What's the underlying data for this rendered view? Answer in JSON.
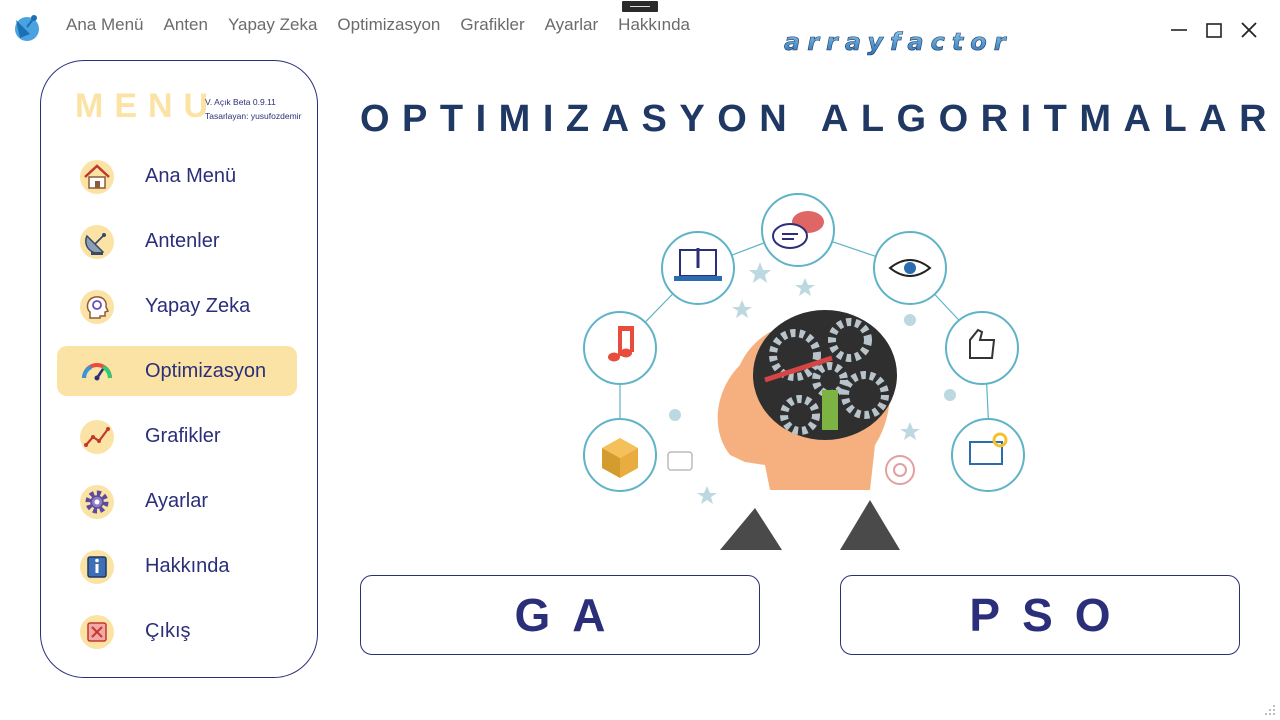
{
  "window": {
    "menu": [
      "Ana Menü",
      "Anten",
      "Yapay Zeka",
      "Optimizasyon",
      "Grafikler",
      "Ayarlar",
      "Hakkında"
    ],
    "wordmark": "arrayfactor"
  },
  "sidebar": {
    "title": "MENU",
    "version": "V. Açık Beta 0.9.11",
    "author": "Tasarlayan: yusufozdemir",
    "items": [
      {
        "label": "Ana Menü",
        "icon": "home-icon"
      },
      {
        "label": "Antenler",
        "icon": "satellite-dish-icon"
      },
      {
        "label": "Yapay Zeka",
        "icon": "ai-head-icon"
      },
      {
        "label": "Optimizasyon",
        "icon": "gauge-icon",
        "active": true
      },
      {
        "label": "Grafikler",
        "icon": "line-chart-icon"
      },
      {
        "label": "Ayarlar",
        "icon": "gear-icon"
      },
      {
        "label": "Hakkında",
        "icon": "info-icon"
      },
      {
        "label": "Çıkış",
        "icon": "exit-icon"
      }
    ]
  },
  "main": {
    "title": "OPTIMIZASYON ALGORITMALARI",
    "buttons": {
      "ga": "GA",
      "pso": "PSO"
    }
  },
  "colors": {
    "accent": "#fbe3a5",
    "primary": "#2b2f7a",
    "title": "#1f3864"
  }
}
